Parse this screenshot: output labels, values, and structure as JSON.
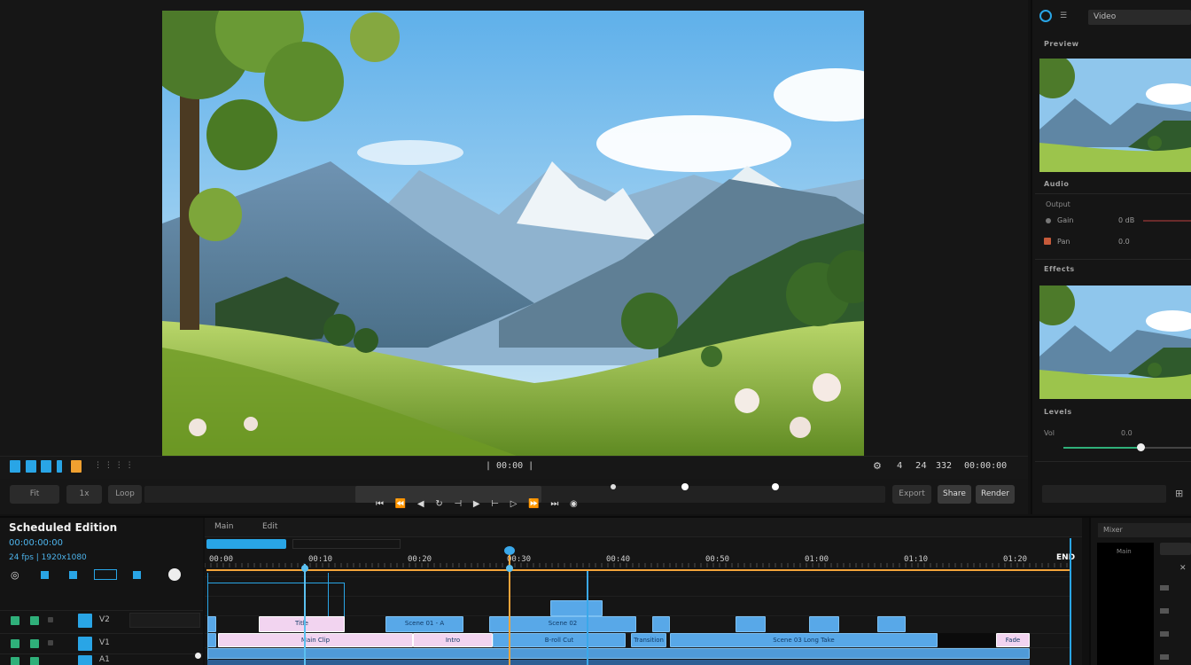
{
  "viewer": {
    "transport": {
      "timecode_center": "| 00:00 |",
      "readout_right": "0:00",
      "speed": "4",
      "fps": "24",
      "frame_count": "332",
      "duration": "00:00:00"
    },
    "buttons": {
      "fit": "Fit",
      "zoom": "1x",
      "loop": "Loop",
      "export": "Export",
      "share": "Share",
      "render": "Render"
    }
  },
  "inspector": {
    "header_label": "Video",
    "sections": {
      "preview": "Preview",
      "audio": "Audio",
      "output": "Output",
      "effects": "Effects",
      "levels": "Levels"
    },
    "rows": {
      "gain_label": "Gain",
      "gain_value": "0 dB",
      "pan_label": "Pan",
      "pan_value": "0.0",
      "vol_label": "Vol",
      "vol_value": "0.0"
    }
  },
  "timeline": {
    "panel_title": "Scheduled Edition",
    "panel_subtitle": "00:00:00:00",
    "panel_meta": "24 fps | 1920x1080",
    "tabs": [
      "Main",
      "Edit"
    ],
    "ruler": [
      "00:00",
      "00:10",
      "00:20",
      "00:30",
      "00:40",
      "00:50",
      "01:00",
      "01:10",
      "01:20"
    ],
    "end_marker": "END",
    "clips": {
      "c1": "Title",
      "c2": "Scene 01 - A",
      "c3": "Scene 02",
      "c4": "Main Clip",
      "c5": "Intro",
      "c6": "B-roll Cut",
      "c7": "Transition",
      "c8": "Scene 03 Long Take",
      "c9": "Fade"
    },
    "track_labels": [
      "V2",
      "V1",
      "A1"
    ]
  },
  "mixer": {
    "title": "Mixer",
    "ch_label": "Main"
  },
  "colors": {
    "accent": "#29a5e6",
    "playhead": "#f3a43a",
    "clip_blue": "#58a8e8",
    "clip_pink": "#f2d4f0"
  }
}
